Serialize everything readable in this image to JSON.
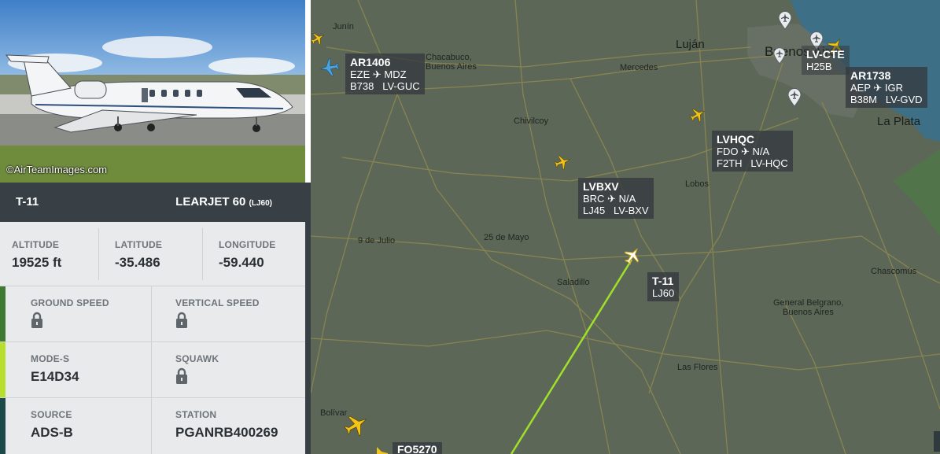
{
  "photo": {
    "credit": "©AirTeamImages.com"
  },
  "aircraft": {
    "registration": "T-11",
    "model": "LEARJET 60",
    "model_code": "(LJ60)"
  },
  "stats": {
    "altitude": {
      "label": "ALTITUDE",
      "value": "19525 ft"
    },
    "latitude": {
      "label": "LATITUDE",
      "value": "-35.486"
    },
    "longitude": {
      "label": "LONGITUDE",
      "value": "-59.440"
    },
    "ground_speed": {
      "label": "GROUND SPEED"
    },
    "vertical_speed": {
      "label": "VERTICAL SPEED"
    },
    "mode_s": {
      "label": "MODE-S",
      "value": "E14D34"
    },
    "squawk": {
      "label": "SQUAWK"
    },
    "source": {
      "label": "SOURCE",
      "value": "ADS-B"
    },
    "station": {
      "label": "STATION",
      "value": "PGANRB400269"
    }
  },
  "colors": {
    "accent_green_dark": "#3f7a32",
    "accent_green_light": "#b8df2e",
    "accent_teal": "#1c4a48",
    "track": "#9fe02a",
    "plane_yellow": "#f2c318"
  },
  "map": {
    "cities": {
      "lujan": "Luján",
      "buenos_aires": "Buenos Aires",
      "la_plata": "La Plata",
      "chacabuco": "Chacabuco,",
      "chacabuco2": "Buenos Aires",
      "mercedes": "Mercedes",
      "chivilcoy": "Chivilcoy",
      "junin": "Junín",
      "nueve_de_julio": "9 de Julio",
      "veinticinco_de_mayo": "25 de Mayo",
      "saladillo": "Saladillo",
      "lobos": "Lobos",
      "chascomus": "Chascomús",
      "general_belgrano": "General Belgrano,",
      "general_belgrano2": "Buenos Aires",
      "las_flores": "Las Flores",
      "bolivar": "Bolívar"
    },
    "flights": {
      "ar1406": {
        "callsign": "AR1406",
        "route": "EZE ✈ MDZ",
        "type": "B738",
        "reg": "LV-GUC"
      },
      "ar1738": {
        "callsign": "AR1738",
        "route": "AEP ✈ IGR",
        "type": "B38M",
        "reg": "LV-GVD"
      },
      "lvcte": {
        "callsign": "LV-CTE",
        "type": "H25B"
      },
      "lvhqc": {
        "callsign": "LVHQC",
        "route": "FDO ✈ N/A",
        "type": "F2TH",
        "reg": "LV-HQC"
      },
      "lvbxv": {
        "callsign": "LVBXV",
        "route": "BRC ✈ N/A",
        "type": "LJ45",
        "reg": "LV-BXV"
      },
      "t11": {
        "callsign": "T-11",
        "type": "LJ60"
      },
      "fo5270": {
        "callsign": "FO5270"
      }
    }
  }
}
